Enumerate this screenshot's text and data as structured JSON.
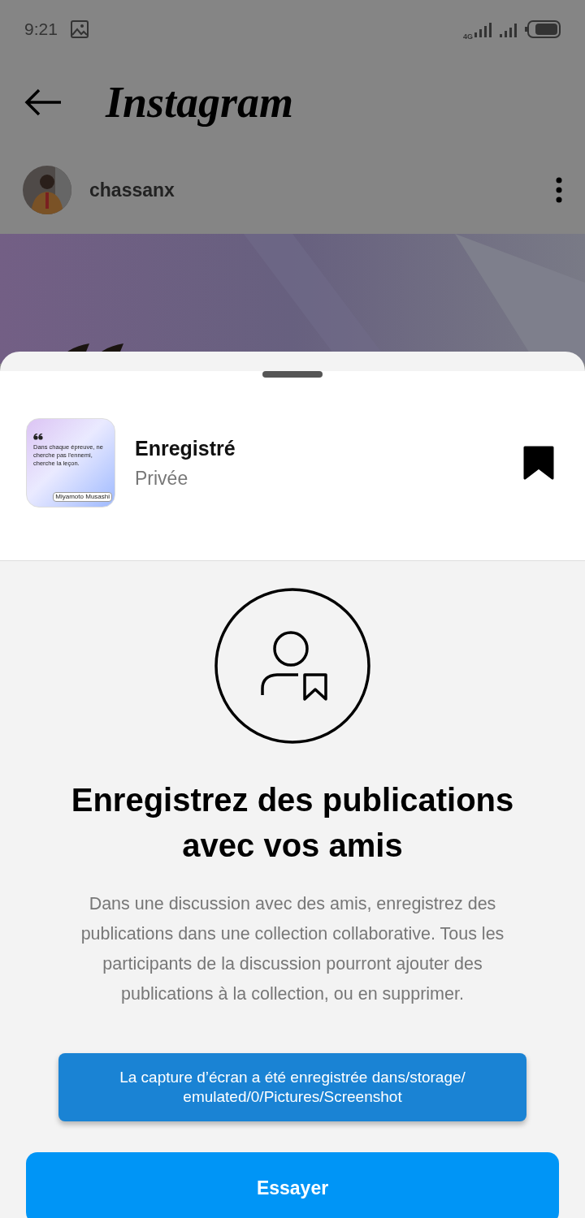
{
  "status_bar": {
    "time": "9:21",
    "network": "4G"
  },
  "header": {
    "title": "Instagram"
  },
  "post": {
    "username": "chassanx"
  },
  "sheet": {
    "collection": {
      "name": "Enregistré",
      "privacy": "Privée",
      "saved": true,
      "thumbnail": {
        "quote": "Dans chaque épreuve, ne cherche pas l'ennemi, cherche la leçon.",
        "author": "Miyamoto Musashi"
      }
    },
    "heading": "Enregistrez des publications avec vos amis",
    "description": "Dans une discussion avec des amis, enregistrez des publications dans une collection collaborative. Tous les participants de la discussion pourront ajouter des publications à la collection, ou en supprimer.",
    "toast": "La capture d’écran a été enregistrée dans/storage/ emulated/0/Pictures/Screenshot",
    "button": "Essayer"
  }
}
